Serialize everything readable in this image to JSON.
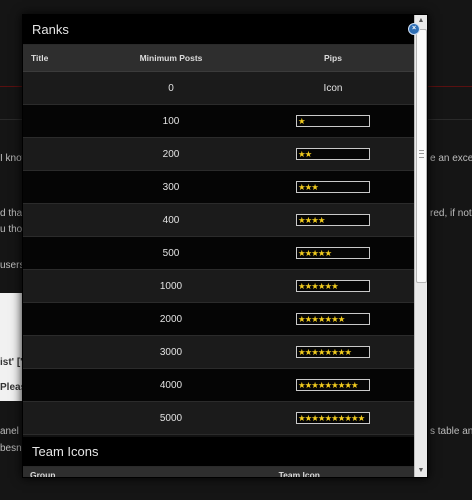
{
  "background": {
    "fragments": [
      "I know",
      "d tha",
      "u thou",
      "users",
      "ist' ['",
      "Please",
      "anel",
      "besn'",
      "e an exce",
      "red, if not",
      "s table an",
      "≡"
    ]
  },
  "modal": {
    "ranks_title": "Ranks",
    "columns": {
      "title": "Title",
      "min_posts": "Minimum Posts",
      "pips": "Pips"
    },
    "rows": [
      {
        "title": "",
        "posts": "0",
        "pips_label": "Icon",
        "pips": 0
      },
      {
        "title": "",
        "posts": "100",
        "pips": 1
      },
      {
        "title": "",
        "posts": "200",
        "pips": 2
      },
      {
        "title": "",
        "posts": "300",
        "pips": 3
      },
      {
        "title": "",
        "posts": "400",
        "pips": 4
      },
      {
        "title": "",
        "posts": "500",
        "pips": 5
      },
      {
        "title": "",
        "posts": "1000",
        "pips": 6
      },
      {
        "title": "",
        "posts": "2000",
        "pips": 7
      },
      {
        "title": "",
        "posts": "3000",
        "pips": 8
      },
      {
        "title": "",
        "posts": "4000",
        "pips": 9
      },
      {
        "title": "",
        "posts": "5000",
        "pips": 10
      }
    ],
    "team_icons_title": "Team Icons",
    "team_columns": {
      "group": "Group",
      "team_icon": "Team Icon"
    },
    "close_symbol": "×",
    "star_color": "#f2cc1e"
  },
  "scrollbar": {
    "up": "▲",
    "down": "▼"
  }
}
